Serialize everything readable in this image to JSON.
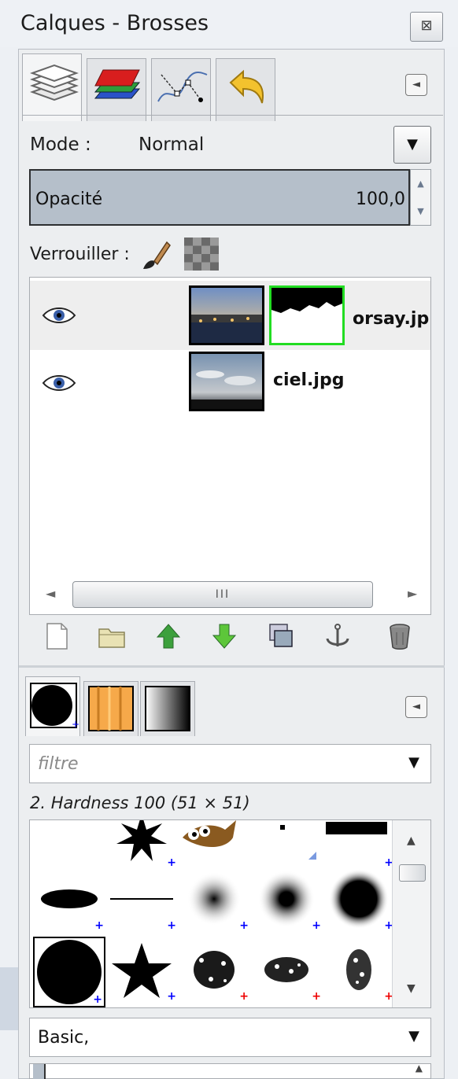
{
  "window": {
    "title": "Calques - Brosses",
    "close_glyph": "⊠"
  },
  "layers_panel": {
    "tabs": [
      {
        "name": "layers-tab-icon",
        "active": true
      },
      {
        "name": "channels-tab-icon",
        "active": false
      },
      {
        "name": "paths-tab-icon",
        "active": false
      },
      {
        "name": "undo-history-tab-icon",
        "active": false
      }
    ],
    "menu_glyph": "◄",
    "mode_label": "Mode :",
    "mode_value": "Normal",
    "mode_dropdown_glyph": "▼",
    "opacity_label": "Opacité",
    "opacity_value": "100,0",
    "spin_up": "▲",
    "spin_down": "▼",
    "lock_label": "Verrouiller :",
    "layers": [
      {
        "name": "orsay.jp",
        "visible": true,
        "has_mask": true,
        "selected": true
      },
      {
        "name": "ciel.jpg",
        "visible": true,
        "has_mask": false,
        "selected": false
      }
    ],
    "scroll_left": "◄",
    "scroll_right": "►",
    "scroll_grip": "III"
  },
  "brushes_panel": {
    "menu_glyph": "◄",
    "filter_placeholder": "filtre",
    "filter_dropdown_glyph": "▼",
    "selected_brush_name": "2. Hardness 100 (51 × 51)",
    "tag_value": "Basic,",
    "tag_dropdown_glyph": "▼",
    "scroll_up": "▲",
    "scroll_down": "▼",
    "plus_glyph": "+"
  },
  "colors": {
    "opacity_fill": "#b5bfca",
    "mask_border": "#22dd22",
    "arrow_up_green": "#3ca03c",
    "arrow_down_green": "#5dc63a"
  }
}
